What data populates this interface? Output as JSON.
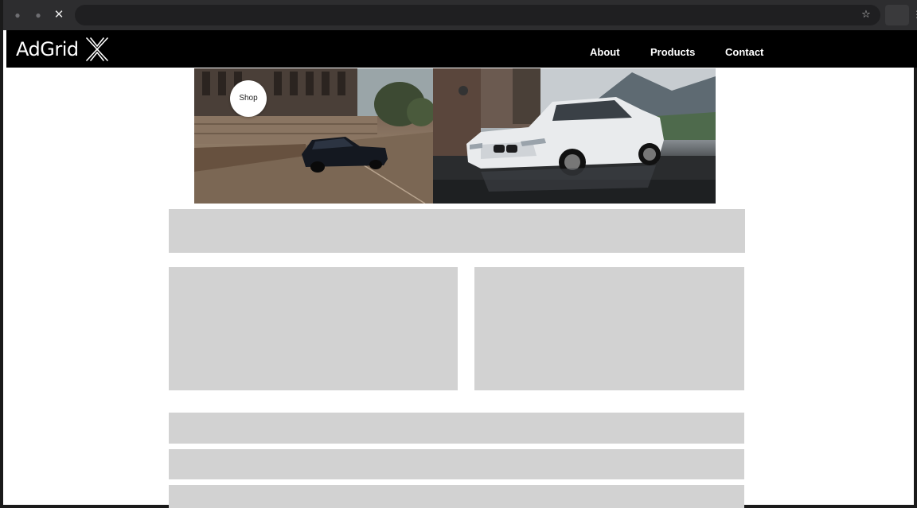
{
  "browser": {
    "back_icon": "arrow-left",
    "forward_icon": "arrow-right",
    "stop_icon": "close",
    "bookmark_icon": "star",
    "menu_icon": "kebab"
  },
  "site": {
    "logo_text": "AdGrid",
    "logo_mark": "crossed-chevrons",
    "nav": [
      {
        "label": "About"
      },
      {
        "label": "Products"
      },
      {
        "label": "Contact"
      }
    ]
  },
  "hero": {
    "shop_label": "Shop",
    "left_image": "dark sedan driving on road",
    "right_image": "white sedan parked on wet pavement"
  },
  "colors": {
    "header_bg": "#000000",
    "chrome_bg": "#2d2d2f",
    "placeholder": "#d2d2d2",
    "page_bg": "#ffffff"
  }
}
